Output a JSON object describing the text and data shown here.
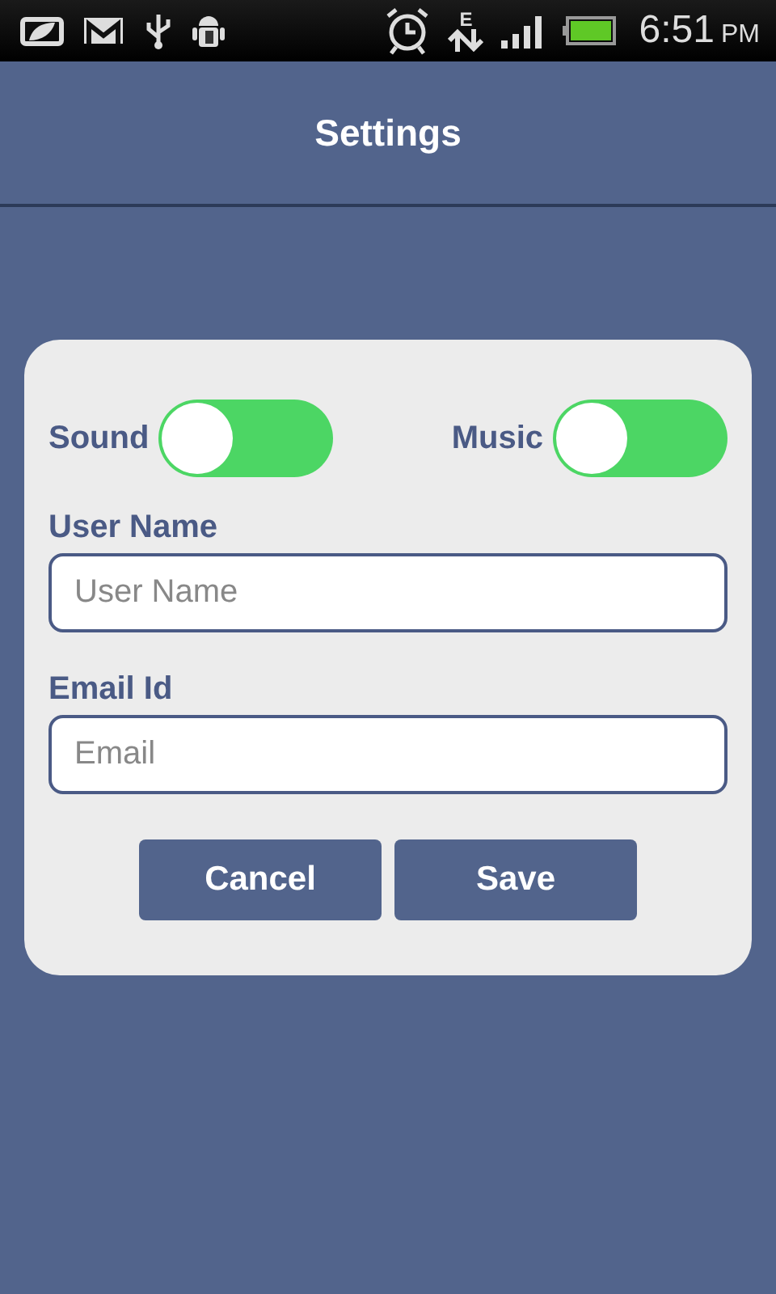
{
  "status_bar": {
    "network_type": "E",
    "time": "6:51",
    "period": "PM"
  },
  "header": {
    "title": "Settings"
  },
  "toggles": [
    {
      "label": "Sound",
      "on": true
    },
    {
      "label": "Music",
      "on": true
    }
  ],
  "fields": [
    {
      "label": "User Name",
      "placeholder": "User Name"
    },
    {
      "label": "Email Id",
      "placeholder": "Email"
    }
  ],
  "buttons": [
    "Cancel",
    "Save"
  ]
}
